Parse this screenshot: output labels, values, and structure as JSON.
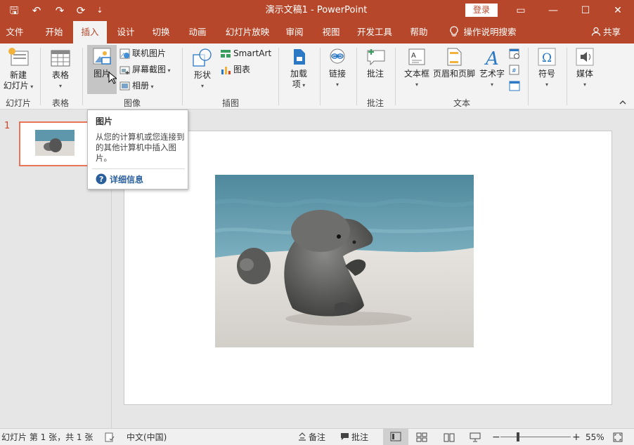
{
  "titlebar": {
    "title": "演示文稿1  -  PowerPoint",
    "login": "登录",
    "qa_save": "🖫",
    "qa_undo": "↶",
    "qa_redo": "↷",
    "qa_present": "⟳",
    "qa_more": "⇣",
    "ribbon_display": "▭",
    "minimize": "—",
    "maximize": "☐",
    "close": "✕"
  },
  "tabs": [
    {
      "label": "文件"
    },
    {
      "label": "开始"
    },
    {
      "label": "插入",
      "active": true
    },
    {
      "label": "设计"
    },
    {
      "label": "切换"
    },
    {
      "label": "动画"
    },
    {
      "label": "幻灯片放映"
    },
    {
      "label": "审阅"
    },
    {
      "label": "视图"
    },
    {
      "label": "开发工具"
    },
    {
      "label": "帮助"
    },
    {
      "label": "操作说明搜索"
    }
  ],
  "share": "共享",
  "ribbon": {
    "new_slide": "新建",
    "new_slide2": "幻灯片",
    "table": "表格",
    "picture": "图片",
    "online_picture": "联机图片",
    "screenshot": "屏幕截图",
    "album": "相册",
    "shapes": "形状",
    "smartart": "SmartArt",
    "chart": "图表",
    "addin": "加载",
    "addin2": "项",
    "link": "链接",
    "comment": "批注",
    "textbox": "文本框",
    "header_footer": "页眉和页脚",
    "wordart": "艺术字",
    "symbol": "符号",
    "media": "媒体",
    "groups": {
      "slides": "幻灯片",
      "tables": "表格",
      "images": "图像",
      "illustrations": "插图",
      "comments": "批注",
      "text": "文本"
    }
  },
  "tooltip": {
    "title": "图片",
    "body": "从您的计算机或您连接到的其他计算机中插入图片。",
    "help": "详细信息"
  },
  "slide_panel": {
    "number": "1"
  },
  "statusbar": {
    "slide_info": "幻灯片 第 1 张，共 1 张",
    "language": "中文(中国)",
    "notes": "备注",
    "comments": "批注",
    "zoom": "55%",
    "zoom_minus": "−",
    "zoom_plus": "+"
  },
  "colors": {
    "accent": "#b7472a",
    "ribbon_bg": "#f3f3f3",
    "thumb_border": "#e8745a"
  }
}
